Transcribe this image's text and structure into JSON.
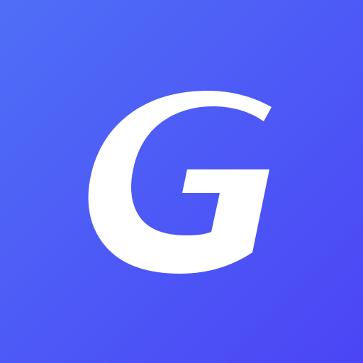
{
  "app_icon": {
    "name": "G app icon",
    "letter": "G",
    "colors": {
      "gradient_start": "#4f6ef7",
      "gradient_end": "#4b45f5",
      "glyph": "#ffffff"
    }
  }
}
